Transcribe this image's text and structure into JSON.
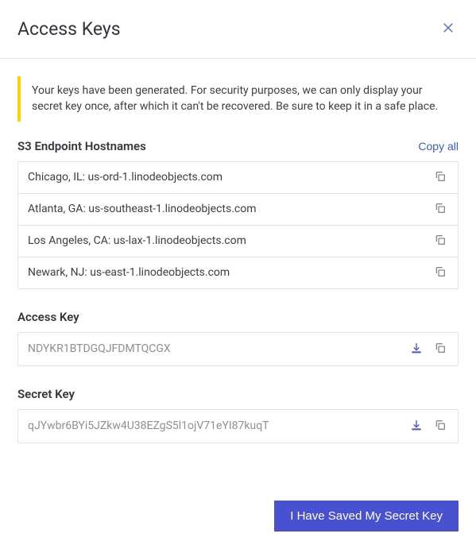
{
  "header": {
    "title": "Access Keys"
  },
  "warning": "Your keys have been generated. For security purposes, we can only display your secret key once, after which it can't be recovered. Be sure to keep it in a safe place.",
  "endpoints": {
    "title": "S3 Endpoint Hostnames",
    "copy_all_label": "Copy all",
    "items": [
      "Chicago, IL: us-ord-1.linodeobjects.com",
      "Atlanta, GA: us-southeast-1.linodeobjects.com",
      "Los Angeles, CA: us-lax-1.linodeobjects.com",
      "Newark, NJ: us-east-1.linodeobjects.com"
    ]
  },
  "access_key": {
    "label": "Access Key",
    "value": "NDYKR1BTDGQJFDMTQCGX"
  },
  "secret_key": {
    "label": "Secret Key",
    "value": "qJYwbr6BYi5JZkw4U38EZgS5l1ojV71eYI87kuqT"
  },
  "footer": {
    "confirm_label": "I Have Saved My Secret Key"
  }
}
